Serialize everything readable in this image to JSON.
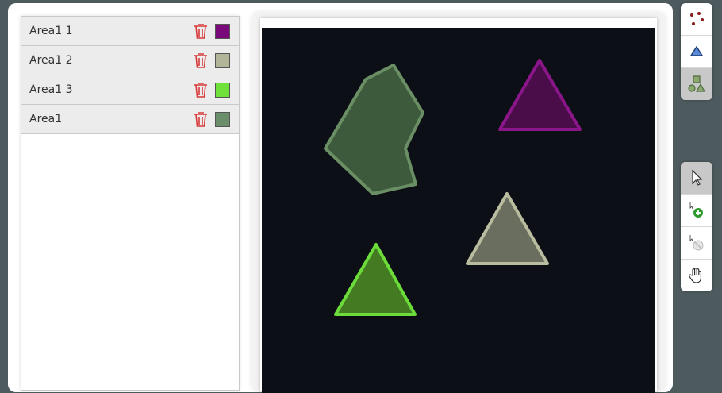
{
  "areas": [
    {
      "label": "Area1 1",
      "color": "#7a0a7a"
    },
    {
      "label": "Area1 2",
      "color": "#b2b598"
    },
    {
      "label": "Area1 3",
      "color": "#6fe13a"
    },
    {
      "label": "Area1",
      "color": "#6a8e6a"
    }
  ],
  "shapes": {
    "polygon": {
      "fill": "#3e5a3c",
      "stroke": "#6b8f64"
    },
    "triangle_purple": {
      "fill": "#4a0d4a",
      "stroke": "#8a168a"
    },
    "triangle_gray": {
      "fill": "#6a6e5e",
      "stroke": "#b9bc9e"
    },
    "triangle_green": {
      "fill": "#437a22",
      "stroke": "#6bdc3a"
    }
  },
  "tool_icons": {
    "top": [
      "points-icon",
      "triangle-icon",
      "shapes-icon"
    ],
    "bottom": [
      "select-cursor-icon",
      "add-point-icon",
      "remove-point-icon",
      "pan-hand-icon"
    ]
  },
  "colors": {
    "trash": "#d63a3a",
    "canvas_background": "#0d0f16"
  }
}
